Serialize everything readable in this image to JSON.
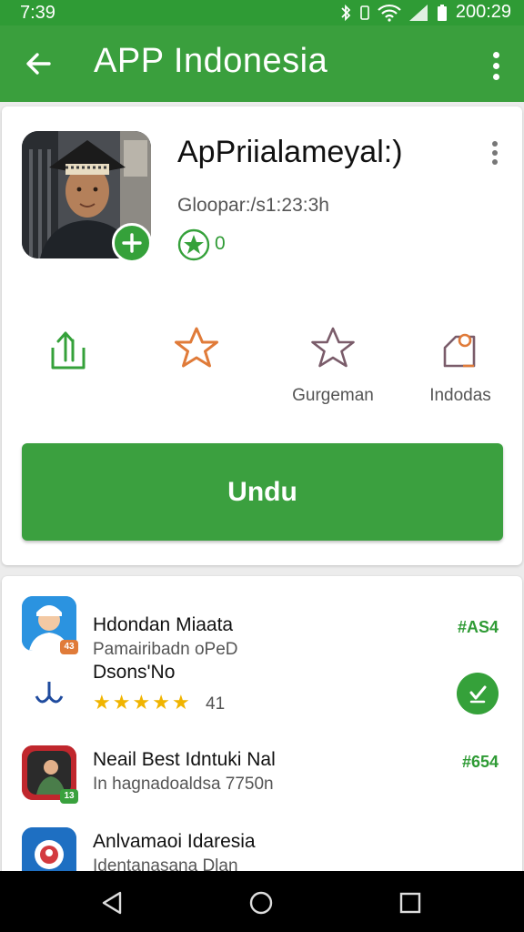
{
  "status_bar": {
    "time": "7:39",
    "clock": "200:29"
  },
  "app_bar": {
    "title": "APP Indonesia"
  },
  "app": {
    "name": "ApPriialameyal:)",
    "subtitle": "Gloopar:/s1:23:3h",
    "rating_count": "0"
  },
  "actions": [
    {
      "icon": "share-icon",
      "label": ""
    },
    {
      "icon": "star-outline-icon",
      "label": ""
    },
    {
      "icon": "star-outline-icon",
      "label": "Gurgeman"
    },
    {
      "icon": "tag-icon",
      "label": "Indodas"
    }
  ],
  "install_button": {
    "label": "Undu"
  },
  "list": [
    {
      "title": "Hdondan Miaata",
      "subtitle": "Pamairibadn oPeD",
      "price": "#AS4",
      "badge": "43"
    },
    {
      "title": "Dsons'No",
      "rating": "41"
    },
    {
      "title": "Neail Best Idntuki Nal",
      "subtitle": "In hagnadoaldsa 7750n",
      "price": "#654",
      "badge": "13"
    },
    {
      "title": "Anlvamaoi Idaresia",
      "subtitle": "Identanasana Dlan"
    }
  ],
  "colors": {
    "primary": "#3a9f3d",
    "accent_orange": "#e07b39",
    "star_gold": "#f0b400"
  }
}
